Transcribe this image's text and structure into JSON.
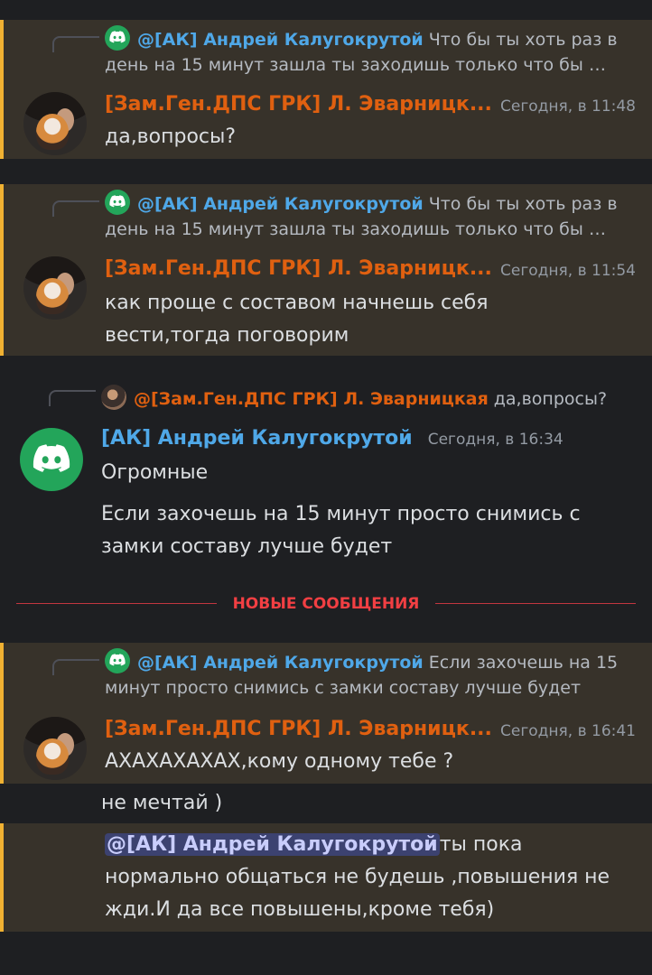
{
  "messages": [
    {
      "reply_author": "@[АК] Андрей Калугокрутой",
      "reply_text_1": "Что бы ты хоть раз в",
      "reply_text_2": "день на 15 минут зашла ты заходишь только что бы …",
      "author": "[Зам.Ген.ДПС ГРК] Л. Эварницк...",
      "time": "Сегодня, в 11:48",
      "text": "да,вопросы?"
    },
    {
      "reply_author": "@[АК] Андрей Калугокрутой",
      "reply_text_1": "Что бы ты хоть раз в",
      "reply_text_2": "день на 15 минут зашла ты заходишь только что бы …",
      "author": "[Зам.Ген.ДПС ГРК] Л. Эварницк...",
      "time": "Сегодня, в 11:54",
      "text_1": "как проще с составом начнешь себя",
      "text_2": "вести,тогда поговорим"
    },
    {
      "reply_author": "@[Зам.Ген.ДПС ГРК] Л. Эварницкая",
      "reply_text_1": "да,вопросы?",
      "author": "[АК] Андрей Калугокрутой",
      "time": "Сегодня, в 16:34",
      "text_1": "Огромные",
      "text_2": "Если захочешь на 15 минут просто снимись с",
      "text_3": "замки составу лучше будет"
    },
    {
      "reply_author": "@[АК] Андрей Калугокрутой",
      "reply_text_1": "Если захочешь на 15",
      "reply_text_2": "минут просто снимись с замки составу лучше будет",
      "author": "[Зам.Ген.ДПС ГРК] Л. Эварницк...",
      "time": "Сегодня, в 16:41",
      "text": "АХАХАХАХАХ,кому одному тебе ?",
      "followup_1": "не мечтай )",
      "followup_2_mention": "@[АК] Андрей Калугокрутой",
      "followup_2_line1": "ты пока",
      "followup_2_line2": "нормально общаться не будешь ,повышения не",
      "followup_2_line3": "жди.И да все повышены,кроме тебя)"
    }
  ],
  "divider_label": "НОВЫЕ СООБЩЕНИЯ",
  "colors": {
    "mention_highlight": "#37322a",
    "mention_border": "#f0b132",
    "author_orange": "#e06010",
    "author_blue": "#4fa8e8",
    "new_messages_red": "#f23f43"
  },
  "icons": [
    "discord-logo-icon",
    "user-photo-avatar"
  ]
}
